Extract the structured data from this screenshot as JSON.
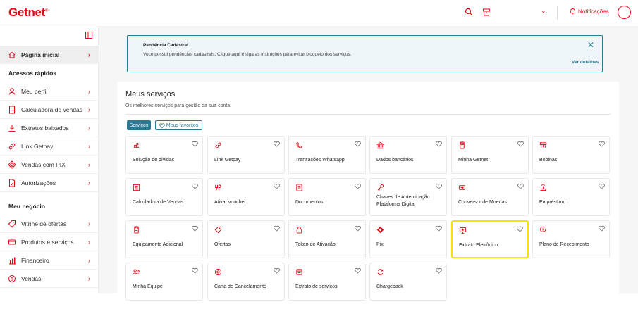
{
  "brand": {
    "logo_text": "Getnet",
    "logo_mark": "®",
    "accent": "#e30613",
    "secondary": "#2a7a95",
    "highlight": "#f5e400"
  },
  "topbar": {
    "notifications_label": "Notificações",
    "icons": [
      "search-icon",
      "store-icon",
      "chevron-down-icon",
      "bell-icon",
      "avatar"
    ]
  },
  "sidebar": {
    "home": "Página inicial",
    "section_quick": "Acessos rápidos",
    "quick_items": [
      {
        "label": "Meu perfil",
        "icon": "user-icon"
      },
      {
        "label": "Calculadora de vendas",
        "icon": "calculator-icon"
      },
      {
        "label": "Extratos baixados",
        "icon": "download-icon"
      },
      {
        "label": "Link Getpay",
        "icon": "link-icon"
      },
      {
        "label": "Vendas com PIX",
        "icon": "pix-icon"
      },
      {
        "label": "Autorizações",
        "icon": "authorization-icon"
      }
    ],
    "section_business": "Meu negócio",
    "business_items": [
      {
        "label": "Vitrine de ofertas",
        "icon": "offers-icon"
      },
      {
        "label": "Produtos e serviços",
        "icon": "products-icon"
      },
      {
        "label": "Financeiro",
        "icon": "finance-icon"
      },
      {
        "label": "Vendas",
        "icon": "sales-icon"
      }
    ]
  },
  "alert": {
    "title": "Pendência Cadastral",
    "text": "Você possui pendências cadastrais. Clique aqui e siga as instruções para evitar bloqueio dos serviços.",
    "link": "Ver detalhes",
    "close": "✕"
  },
  "services": {
    "title": "Meus serviços",
    "subtitle": "Os melhores serviços para gestão da sua conta.",
    "tab_services": "Serviços",
    "tab_favorites": "Meus favoritos",
    "items": [
      {
        "label": "Solução de dívidas",
        "icon": "debt-icon"
      },
      {
        "label": "Link Getpay",
        "icon": "link-icon"
      },
      {
        "label": "Transações Whatsapp",
        "icon": "whatsapp-icon"
      },
      {
        "label": "Dados bancários",
        "icon": "bank-icon"
      },
      {
        "label": "Minha Getnet",
        "icon": "pos-icon"
      },
      {
        "label": "Bobinas",
        "icon": "paper-roll-icon"
      },
      {
        "label": "Calculadora de Vendas",
        "icon": "calculator-icon"
      },
      {
        "label": "Ativar voucher",
        "icon": "voucher-icon"
      },
      {
        "label": "Documentos",
        "icon": "document-icon"
      },
      {
        "label": "Chaves de Autenticação Plataforma Digital",
        "icon": "key-icon"
      },
      {
        "label": "Conversor de Moedas",
        "icon": "currency-icon"
      },
      {
        "label": "Empréstimo",
        "icon": "loan-icon"
      },
      {
        "label": "Equipamento Adicional",
        "icon": "pos-icon"
      },
      {
        "label": "Ofertas",
        "icon": "tag-icon"
      },
      {
        "label": "Token de Ativação",
        "icon": "lock-icon"
      },
      {
        "label": "Pix",
        "icon": "pix-icon"
      },
      {
        "label": "Extrato Eletrônico",
        "icon": "statement-icon"
      },
      {
        "label": "Plano de Recebimento",
        "icon": "plan-icon"
      },
      {
        "label": "Minha Equipe",
        "icon": "team-icon"
      },
      {
        "label": "Carta de Cancelamento",
        "icon": "cancel-letter-icon"
      },
      {
        "label": "Extrato de serviços",
        "icon": "services-statement-icon"
      },
      {
        "label": "Chargeback",
        "icon": "chargeback-icon"
      }
    ]
  }
}
